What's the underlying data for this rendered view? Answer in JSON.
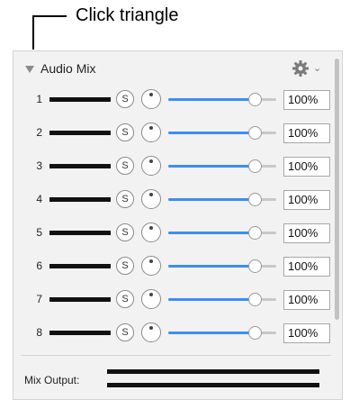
{
  "callout": {
    "text": "Click triangle"
  },
  "panel": {
    "title": "Audio Mix",
    "gear_caret": "⌄"
  },
  "channels": [
    {
      "number": "1",
      "solo_label": "S",
      "volume_text": "100%",
      "volume_level": 0.8
    },
    {
      "number": "2",
      "solo_label": "S",
      "volume_text": "100%",
      "volume_level": 0.8
    },
    {
      "number": "3",
      "solo_label": "S",
      "volume_text": "100%",
      "volume_level": 0.8
    },
    {
      "number": "4",
      "solo_label": "S",
      "volume_text": "100%",
      "volume_level": 0.8
    },
    {
      "number": "5",
      "solo_label": "S",
      "volume_text": "100%",
      "volume_level": 0.8
    },
    {
      "number": "6",
      "solo_label": "S",
      "volume_text": "100%",
      "volume_level": 0.8
    },
    {
      "number": "7",
      "solo_label": "S",
      "volume_text": "100%",
      "volume_level": 0.8
    },
    {
      "number": "8",
      "solo_label": "S",
      "volume_text": "100%",
      "volume_level": 0.8
    }
  ],
  "mix_output": {
    "label": "Mix Output:"
  },
  "colors": {
    "slider_fill": "#3b8ef3",
    "meter": "#111111",
    "panel_bg": "#f2f2f2"
  }
}
